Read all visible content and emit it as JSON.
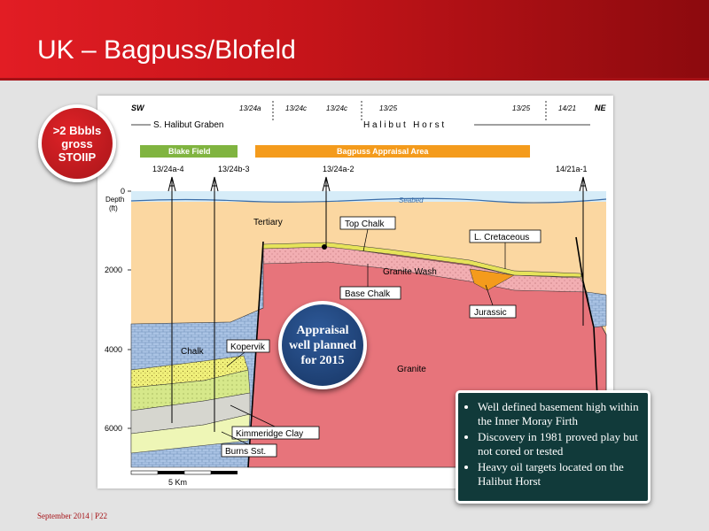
{
  "slide": {
    "title": "UK – Bagpuss/Blofeld",
    "footer": "September 2014 | P22"
  },
  "badge": {
    "lines": [
      ">2 Bbbls",
      "gross",
      "STOIIP"
    ]
  },
  "planned": {
    "lines": [
      "Appraisal",
      "well planned",
      "for 2015"
    ]
  },
  "notes": [
    "Well defined basement high within the Inner Moray Firth",
    "Discovery in 1981 proved play but not cored or tested",
    "Heavy oil targets located on the Halibut Horst"
  ],
  "section": {
    "direction_left": "SW",
    "direction_right": "NE",
    "blocks": [
      "13/24a",
      "13/24c",
      "13/24c",
      "13/25",
      "13/25",
      "14/21"
    ],
    "graben_label": "S. Halibut Graben",
    "horst_label": "H a l i b u t   H o r s t",
    "blake_label": "Blake Field",
    "bagpuss_label": "Bagpuss Appraisal Area",
    "wells": [
      "13/24a-4",
      "13/24b-3",
      "13/24a-2",
      "14/21a-1"
    ],
    "depth_title": [
      "Depth",
      "(ft)"
    ],
    "depth_ticks": [
      "0",
      "2000",
      "4000",
      "6000"
    ],
    "seabed": "Seabed",
    "units": {
      "tertiary": "Tertiary",
      "top_chalk": "Top Chalk",
      "l_cretaceous": "L. Cretaceous",
      "granite_wash": "Granite Wash",
      "base_chalk": "Base Chalk",
      "jurassic": "Jurassic",
      "chalk": "Chalk",
      "kopervik": "Kopervik",
      "granite": "Granite",
      "kimmeridge": "Kimmeridge Clay",
      "burns": "Burns Sst."
    },
    "scale": "5 Km"
  },
  "colors": {
    "brand_red": "#c41419",
    "tertiary": "#fbd7a1",
    "granite": "#e7747b",
    "chalk": "#adc6e6",
    "blake": "#80b440",
    "bagpuss": "#f49b1c"
  }
}
